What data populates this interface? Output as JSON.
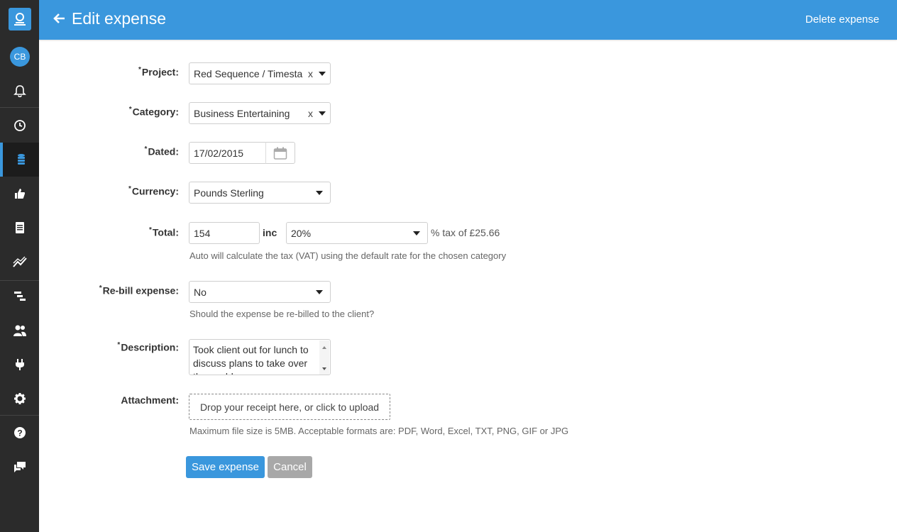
{
  "user": {
    "initials": "CB"
  },
  "colors": {
    "brand": "#3a97dd",
    "sidebar": "#2b2b2b",
    "cancel": "#a8a8a8"
  },
  "sidebar": {
    "items": [
      {
        "icon": "bell-icon"
      },
      {
        "icon": "clock-icon"
      },
      {
        "icon": "coins-icon",
        "active": true
      },
      {
        "icon": "thumbs-up-icon"
      },
      {
        "icon": "document-icon"
      },
      {
        "icon": "trend-chart-icon"
      },
      {
        "icon": "gantt-icon"
      },
      {
        "icon": "users-icon"
      },
      {
        "icon": "plug-icon"
      },
      {
        "icon": "gear-icon"
      },
      {
        "icon": "help-icon"
      },
      {
        "icon": "chat-icon"
      }
    ]
  },
  "header": {
    "title": "Edit expense",
    "delete_label": "Delete expense"
  },
  "form": {
    "required_mark": "*",
    "project": {
      "label": "Project:",
      "value": "Red Sequence / Timesta",
      "clear": "x"
    },
    "category": {
      "label": "Category:",
      "value": "Business Entertaining",
      "clear": "x"
    },
    "dated": {
      "label": "Dated:",
      "value": "17/02/2015"
    },
    "currency": {
      "label": "Currency:",
      "value": "Pounds Sterling"
    },
    "total": {
      "label": "Total:",
      "value": "154",
      "inc": "inc",
      "tax_rate": "20%",
      "tax_text": "% tax of £25.66",
      "help": "Auto will calculate the tax (VAT) using the default rate for the chosen category"
    },
    "rebill": {
      "label": "Re-bill expense:",
      "value": "No",
      "help": "Should the expense be re-billed to the client?"
    },
    "description": {
      "label": "Description:",
      "value": "Took client out for lunch to discuss plans to take over the world"
    },
    "attachment": {
      "label": "Attachment:",
      "drop_text": "Drop your receipt here, or click to upload",
      "help": "Maximum file size is 5MB. Acceptable formats are: PDF, Word, Excel, TXT, PNG, GIF or JPG"
    },
    "save_label": "Save expense",
    "cancel_label": "Cancel"
  }
}
